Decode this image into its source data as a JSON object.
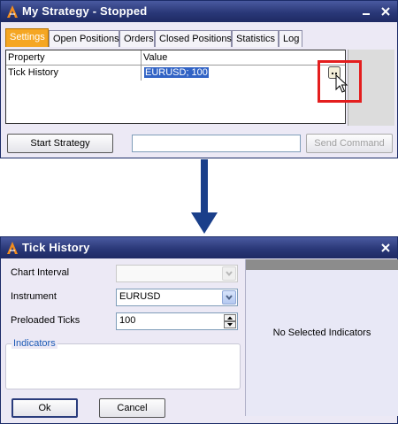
{
  "strategy_window": {
    "title": "My Strategy - Stopped",
    "tabs": [
      {
        "label": "Settings",
        "active": true
      },
      {
        "label": "Open Positions"
      },
      {
        "label": "Orders"
      },
      {
        "label": "Closed Positions"
      },
      {
        "label": "Statistics"
      },
      {
        "label": "Log"
      }
    ],
    "grid": {
      "headers": [
        "Property",
        "Value"
      ],
      "rows": [
        {
          "property": "Tick History",
          "value": "EURUSD; 100"
        }
      ]
    },
    "start_button": "Start Strategy",
    "command_input": "",
    "send_button": "Send Command"
  },
  "tick_dialog": {
    "title": "Tick History",
    "chart_interval_label": "Chart Interval",
    "chart_interval_value": "",
    "instrument_label": "Instrument",
    "instrument_value": "EURUSD",
    "preloaded_label": "Preloaded Ticks",
    "preloaded_value": "100",
    "indicators_label": "Indicators",
    "no_selected": "No Selected Indicators",
    "ok_button": "Ok",
    "cancel_button": "Cancel"
  },
  "colors": {
    "title_bar": "#2a3878",
    "active_tab": "#f5a623",
    "highlight_box": "#e41e1e",
    "arrow": "#1a3f8a",
    "selection": "#3163c5"
  },
  "icons": [
    "app-logo-icon",
    "minimize-icon",
    "close-icon",
    "ellipsis-edit-icon",
    "mouse-pointer-icon",
    "down-arrow-icon",
    "chevron-down-icon",
    "spin-up-icon",
    "spin-down-icon"
  ]
}
